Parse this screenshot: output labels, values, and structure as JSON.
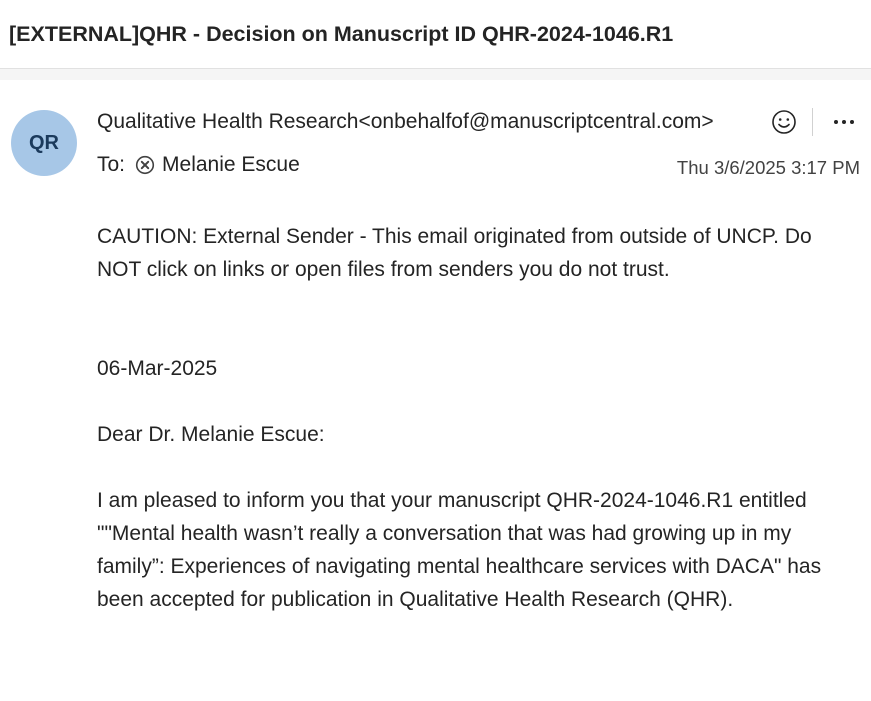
{
  "email": {
    "subject": "[EXTERNAL]QHR - Decision on Manuscript ID QHR-2024-1046.R1",
    "avatar_initials": "QR",
    "sender": "Qualitative Health Research<onbehalfof@manuscriptcentral.com>",
    "to_label": "To:",
    "recipient": "Melanie Escue",
    "date": "Thu 3/6/2025 3:17 PM",
    "icons": {
      "react": "smiley-icon",
      "more": "more-options-icon",
      "recipient_status": "circle-x-icon"
    },
    "colors": {
      "avatar_bg": "#a7c7e7",
      "avatar_text": "#1b3a5c"
    }
  },
  "body": {
    "caution": "CAUTION: External Sender - This email originated from outside of UNCP. Do NOT click on links or open files from senders you do not trust.",
    "date_line": "06-Mar-2025",
    "greeting": "Dear Dr. Melanie Escue:",
    "paragraph": "I am pleased to inform you that your manuscript QHR-2024-1046.R1 entitled \"\"Mental health wasn’t really a conversation that was had growing up in my family”: Experiences of navigating mental healthcare services with DACA\" has been accepted for publication in Qualitative Health Research (QHR)."
  }
}
